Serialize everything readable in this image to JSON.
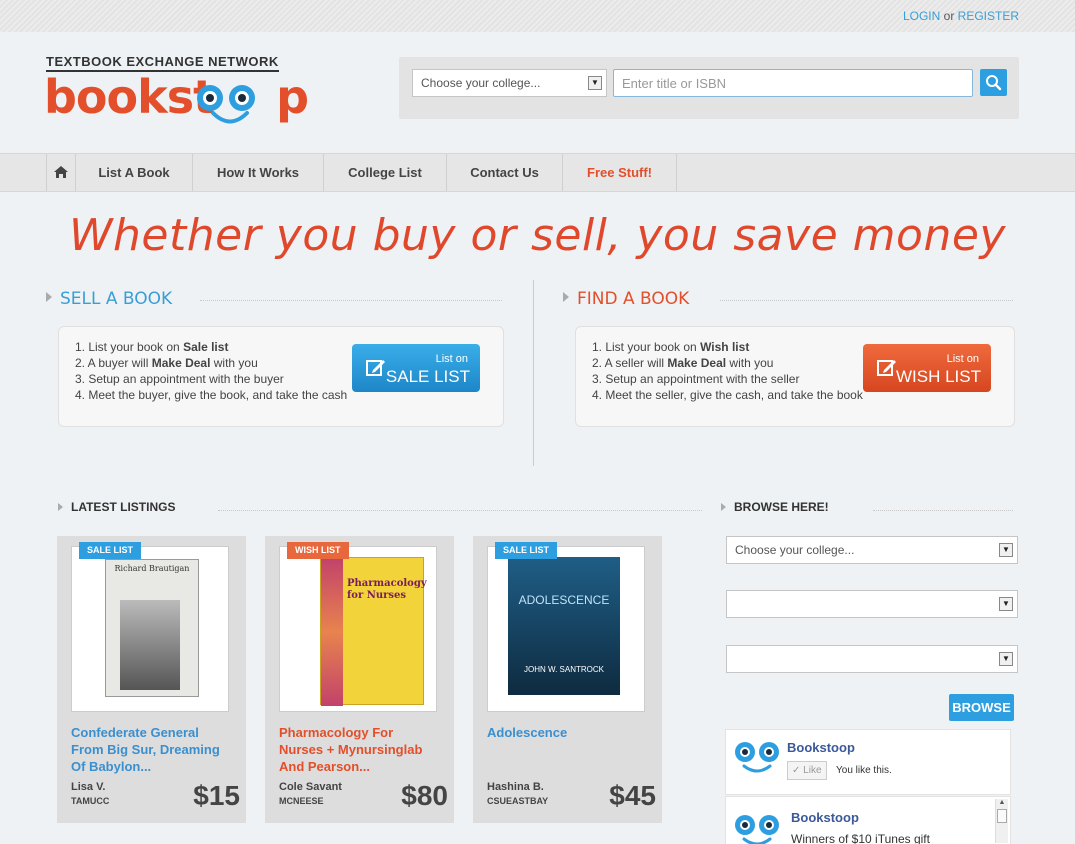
{
  "topbar": {
    "login": "LOGIN",
    "or": "or",
    "register": "REGISTER"
  },
  "logo": {
    "tagline": "TEXTBOOK EXCHANGE NETWORK",
    "word": "bookst",
    "word_tail": "p"
  },
  "search": {
    "college_placeholder": "Choose your college...",
    "input_placeholder": "Enter title or ISBN"
  },
  "nav": {
    "items": [
      {
        "label": "List A Book"
      },
      {
        "label": "How It Works"
      },
      {
        "label": "College List"
      },
      {
        "label": "Contact Us"
      },
      {
        "label": "Free Stuff!"
      }
    ]
  },
  "headline": "Whether you buy or sell, you save money",
  "sell": {
    "title": "SELL A BOOK",
    "steps": [
      [
        "1. List your book on ",
        "Sale list",
        ""
      ],
      [
        "2. A buyer will ",
        "Make Deal",
        " with you"
      ],
      [
        "3. Setup an appointment with the buyer",
        "",
        ""
      ],
      [
        "4. Meet the buyer, give the book, and take the cash",
        "",
        ""
      ]
    ],
    "btn_small": "List on",
    "btn_large": "SALE LIST"
  },
  "find": {
    "title": "FIND A BOOK",
    "steps": [
      [
        "1. List your book on ",
        "Wish list",
        ""
      ],
      [
        "2. A seller will ",
        "Make Deal",
        " with you"
      ],
      [
        "3. Setup an appointment with the seller",
        "",
        ""
      ],
      [
        "4. Meet the seller, give the cash, and take the book",
        "",
        ""
      ]
    ],
    "btn_small": "List on",
    "btn_large": "WISH LIST"
  },
  "latest": {
    "title": "LATEST LISTINGS",
    "items": [
      {
        "tag": "SALE LIST",
        "title": "Confederate General From Big Sur, Dreaming Of Babylon...",
        "seller": "Lisa V.",
        "school": "TAMUCC",
        "price": "$15",
        "cover_text": "Richard Brautigan"
      },
      {
        "tag": "WISH LIST",
        "title": "Pharmacology For Nurses + Mynursinglab And Pearson...",
        "seller": "Cole Savant",
        "school": "MCNEESE",
        "price": "$80",
        "cover_text": "Pharmacology for Nurses"
      },
      {
        "tag": "SALE LIST",
        "title": "Adolescence",
        "seller": "Hashina B.",
        "school": "CSUEASTBAY",
        "price": "$45",
        "cover_text": "ADOLESCENCE",
        "cover_author": "JOHN W. SANTROCK"
      }
    ]
  },
  "browse": {
    "title": "BROWSE HERE!",
    "college_placeholder": "Choose your college...",
    "button": "BROWSE"
  },
  "facebook": {
    "page_name": "Bookstoop",
    "like": "Like",
    "you_like": "You like this.",
    "post_name": "Bookstoop",
    "post_text": "Winners of $10 iTunes gift"
  },
  "colors": {
    "accent_blue": "#2d9fe0",
    "accent_orange": "#e24f2a"
  }
}
